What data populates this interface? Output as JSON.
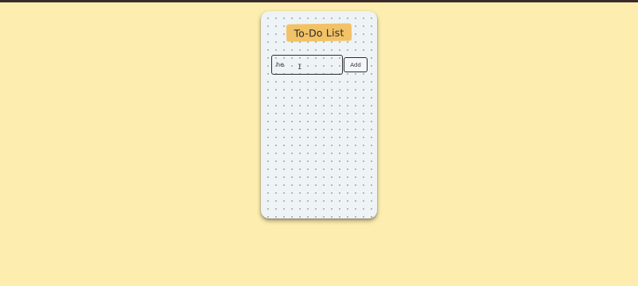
{
  "app": {
    "title": "To-Do List"
  },
  "todo_form": {
    "input_value": "he",
    "input_placeholder": "",
    "add_label": "Add"
  },
  "colors": {
    "page_background": "#fdeeb0",
    "card_background": "#eef3f5",
    "title_highlight": "#f2c266",
    "border": "#2c2c2c"
  },
  "icons": {
    "cursor": "text-cursor-icon"
  }
}
